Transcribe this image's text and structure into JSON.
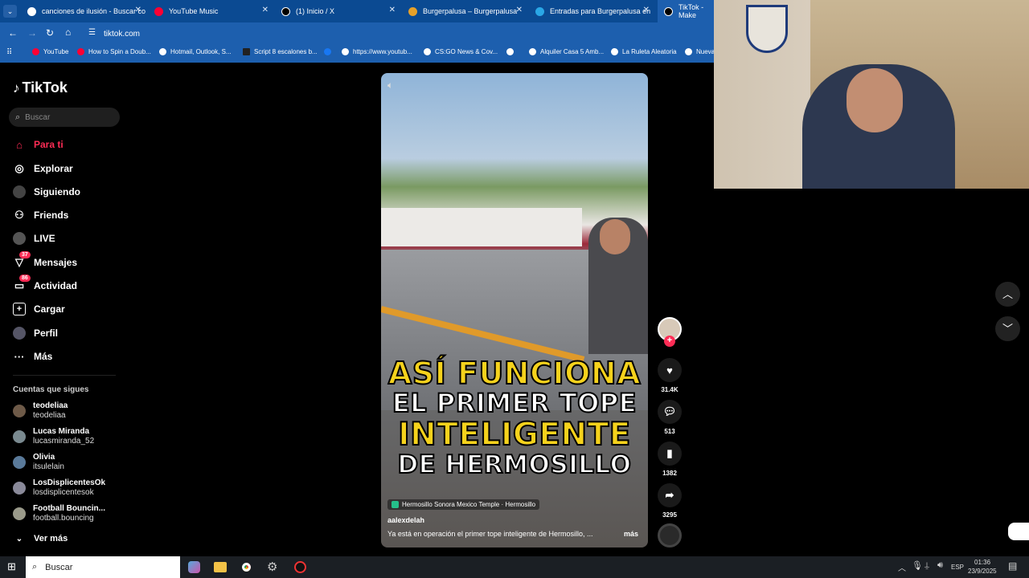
{
  "browser": {
    "tabs": [
      {
        "label": "canciones de ilusión - Buscar co",
        "color": "#ffffff"
      },
      {
        "label": "YouTube Music",
        "color": "#ff0033"
      },
      {
        "label": "(1) Inicio / X",
        "color": "#000000"
      },
      {
        "label": "Burgerpalusa – Burgerpalusa",
        "color": "#e6a12a"
      },
      {
        "label": "Entradas para Burgerpalusa en",
        "color": "#2aa7e6"
      },
      {
        "label": "TikTok - Make",
        "color": "#000000"
      }
    ],
    "url": "tiktok.com",
    "bookmarks": [
      "YouTube",
      "How to Spin a Doub...",
      "Hotmail, Outlook, S...",
      "Script 8 escalones b...",
      "",
      "https://www.youtub...",
      "CS:GO News & Cov...",
      "",
      "Alquiler Casa 5 Amb...",
      "La Ruleta Aleatoria",
      "Nueva"
    ]
  },
  "tiktok": {
    "logo": "TikTok",
    "search_placeholder": "Buscar",
    "nav": [
      {
        "label": "Para ti",
        "icon": "home-icon",
        "active": true
      },
      {
        "label": "Explorar",
        "icon": "compass-icon"
      },
      {
        "label": "Siguiendo",
        "icon": "following-icon"
      },
      {
        "label": "Friends",
        "icon": "friends-icon"
      },
      {
        "label": "LIVE",
        "icon": "live-icon"
      },
      {
        "label": "Mensajes",
        "icon": "messages-icon",
        "badge": "37"
      },
      {
        "label": "Actividad",
        "icon": "activity-icon",
        "badge": "86"
      },
      {
        "label": "Cargar",
        "icon": "upload-icon"
      },
      {
        "label": "Perfil",
        "icon": "profile-icon"
      },
      {
        "label": "Más",
        "icon": "more-icon"
      }
    ],
    "following_title": "Cuentas que sigues",
    "accounts": [
      {
        "name": "teodeliaa",
        "handle": "teodeliaa"
      },
      {
        "name": "Lucas Miranda",
        "handle": "lucasmiranda_52"
      },
      {
        "name": "Olivia",
        "handle": "itsulelain"
      },
      {
        "name": "LosDisplicentesOk",
        "handle": "losdisplicentesok"
      },
      {
        "name": "Football Bouncin...",
        "handle": "football.bouncing"
      }
    ],
    "see_more": "Ver más",
    "video": {
      "caption_lines": [
        "ASÍ FUNCIONA",
        "EL PRIMER TOPE",
        "INTELIGENTE",
        "DE HERMOSILLO"
      ],
      "location": "Hermosillo Sonora Mexico Temple · Hermosillo",
      "author": "aalexdelah",
      "description": "Ya está en operación el primer tope inteligente de Hermosillo, ...",
      "more": "más"
    },
    "actions": {
      "likes": "31.4K",
      "comments": "513",
      "saves": "1382",
      "shares": "3295"
    }
  },
  "taskbar": {
    "search": "Buscar",
    "lang": "ESP",
    "time": "01:36",
    "date": "23/9/2025"
  }
}
